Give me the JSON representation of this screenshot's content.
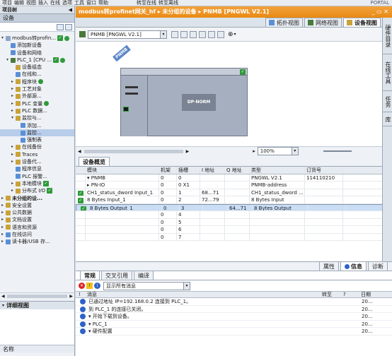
{
  "toolbar": {
    "items": [
      "项目",
      "编辑",
      "视图",
      "插入",
      "在线",
      "选项",
      "工具",
      "窗口",
      "帮助"
    ],
    "online_label": "转至在线",
    "offline_label": "转至离线",
    "brand": "PORTAL"
  },
  "left": {
    "title": "项目树",
    "devices_label": "设备",
    "tree": [
      {
        "label": "modbus转profin...",
        "indent": 0,
        "arrow": "▾",
        "icon": "#8ca6c8",
        "check": true,
        "dot": true
      },
      {
        "label": "添加新设备",
        "indent": 1,
        "arrow": "",
        "icon": "#5a8fd6",
        "check": false,
        "dot": false
      },
      {
        "label": "设备和网络",
        "indent": 1,
        "arrow": "",
        "icon": "#5a8fd6",
        "check": false,
        "dot": false
      },
      {
        "label": "PLC_1 [CPU ...",
        "indent": 1,
        "arrow": "▾",
        "icon": "#4a7a3a",
        "check": true,
        "dot": true
      },
      {
        "label": "设备组态",
        "indent": 2,
        "arrow": "",
        "icon": "#c9a23a",
        "check": false,
        "dot": false
      },
      {
        "label": "在线和...",
        "indent": 2,
        "arrow": "",
        "icon": "#5a8fd6",
        "check": false,
        "dot": false
      },
      {
        "label": "程序块",
        "indent": 2,
        "arrow": "▸",
        "icon": "#c9a23a",
        "check": false,
        "dot": true
      },
      {
        "label": "工艺对象",
        "indent": 2,
        "arrow": "▸",
        "icon": "#c9a23a",
        "check": false,
        "dot": false
      },
      {
        "label": "外部源...",
        "indent": 2,
        "arrow": "▸",
        "icon": "#c9a23a",
        "check": false,
        "dot": false
      },
      {
        "label": "PLC 变量",
        "indent": 2,
        "arrow": "▸",
        "icon": "#c9a23a",
        "check": false,
        "dot": true
      },
      {
        "label": "PLC 数据...",
        "indent": 2,
        "arrow": "▸",
        "icon": "#c9a23a",
        "check": false,
        "dot": false
      },
      {
        "label": "监控与...",
        "indent": 2,
        "arrow": "▾",
        "icon": "#c9a23a",
        "check": false,
        "dot": false
      },
      {
        "label": "添加...",
        "indent": 3,
        "arrow": "",
        "icon": "#5a8fd6",
        "check": false,
        "dot": false
      },
      {
        "label": "监控...",
        "indent": 3,
        "arrow": "",
        "icon": "#5a8fd6",
        "check": false,
        "dot": false,
        "selected": true
      },
      {
        "label": "强制表",
        "indent": 3,
        "arrow": "",
        "icon": "#5a8fd6",
        "check": false,
        "dot": false
      },
      {
        "label": "在线备份",
        "indent": 2,
        "arrow": "▸",
        "icon": "#c9a23a",
        "check": false,
        "dot": false
      },
      {
        "label": "Traces",
        "indent": 2,
        "arrow": "▸",
        "icon": "#c9a23a",
        "check": false,
        "dot": false
      },
      {
        "label": "设备代...",
        "indent": 2,
        "arrow": "▸",
        "icon": "#c9a23a",
        "check": false,
        "dot": false
      },
      {
        "label": "程序信息",
        "indent": 2,
        "arrow": "",
        "icon": "#5a8fd6",
        "check": false,
        "dot": false
      },
      {
        "label": "PLC 报警...",
        "indent": 2,
        "arrow": "",
        "icon": "#5a8fd6",
        "check": false,
        "dot": false
      },
      {
        "label": "本地模块",
        "indent": 2,
        "arrow": "▸",
        "icon": "#c9a23a",
        "check": true,
        "dot": false
      },
      {
        "label": "分布式 I/O",
        "indent": 2,
        "arrow": "▸",
        "icon": "#c9a23a",
        "check": true,
        "dot": false
      },
      {
        "label": "未分组的设...",
        "indent": 0,
        "arrow": "▸",
        "icon": "#c9a23a",
        "check": false,
        "dot": false,
        "bold": true
      },
      {
        "label": "安全设置",
        "indent": 0,
        "arrow": "▸",
        "icon": "#c9a23a",
        "check": false,
        "dot": false
      },
      {
        "label": "公共数据",
        "indent": 0,
        "arrow": "▸",
        "icon": "#c9a23a",
        "check": false,
        "dot": false
      },
      {
        "label": "文档设置",
        "indent": 0,
        "arrow": "▸",
        "icon": "#c9a23a",
        "check": false,
        "dot": false
      },
      {
        "label": "语言和资源",
        "indent": 0,
        "arrow": "▸",
        "icon": "#c9a23a",
        "check": false,
        "dot": false
      },
      {
        "label": "在线访问",
        "indent": 0,
        "arrow": "▸",
        "icon": "#5a8fd6",
        "check": false,
        "dot": false
      },
      {
        "label": "读卡器/USB 存...",
        "indent": 0,
        "arrow": "▸",
        "icon": "#5a8fd6",
        "check": false,
        "dot": false
      }
    ],
    "detail_title": "详细视图",
    "detail_col": "名称"
  },
  "main": {
    "title": "modbus转profinet网关_hf  ▸  未分组的设备  ▸  PNMB [PNGWL V2.1]",
    "tabs": [
      "拓扑视图",
      "网络视图",
      "设备视图"
    ],
    "device_select": "PNMB [PNGWL V2.1]",
    "device_tag": "PNMB",
    "module_label": "DP-NORM",
    "zoom": "100%"
  },
  "overview": {
    "tab": "设备概览",
    "columns": [
      "",
      "模块",
      "机架",
      "插槽",
      "I 地址",
      "Q 地址",
      "类型",
      "订货号"
    ],
    "rows": [
      {
        "check": false,
        "module": "▾  PNMB",
        "rack": "0",
        "slot": "0",
        "i": "",
        "q": "",
        "type": "PNGWL V2.1",
        "order": "114110210"
      },
      {
        "check": false,
        "module": "     ▸  PN-IO",
        "rack": "0",
        "slot": "0 X1",
        "i": "",
        "q": "",
        "type": "PNMB-address",
        "order": ""
      },
      {
        "check": true,
        "module": "CH1_status_dword Input_1",
        "rack": "0",
        "slot": "1",
        "i": "68...71",
        "q": "",
        "type": "CH1_status_dword ...",
        "order": ""
      },
      {
        "check": true,
        "module": "8 Bytes Input_1",
        "rack": "0",
        "slot": "2",
        "i": "72...79",
        "q": "",
        "type": "8 Bytes Input",
        "order": ""
      },
      {
        "check": true,
        "module": "8 Bytes Output_1",
        "rack": "0",
        "slot": "3",
        "i": "",
        "q": "64...71",
        "type": "8 Bytes Output",
        "order": "",
        "selected": true
      },
      {
        "check": false,
        "module": "",
        "rack": "0",
        "slot": "4",
        "i": "",
        "q": "",
        "type": "",
        "order": ""
      },
      {
        "check": false,
        "module": "",
        "rack": "0",
        "slot": "5",
        "i": "",
        "q": "",
        "type": "",
        "order": ""
      },
      {
        "check": false,
        "module": "",
        "rack": "0",
        "slot": "6",
        "i": "",
        "q": "",
        "type": "",
        "order": ""
      },
      {
        "check": false,
        "module": "",
        "rack": "0",
        "slot": "7",
        "i": "",
        "q": "",
        "type": "",
        "order": ""
      }
    ]
  },
  "inspector": {
    "top_tabs": [
      "属性",
      "信息",
      "诊断"
    ],
    "tabs": [
      "常规",
      "交叉引用",
      "编译"
    ],
    "filter": "显示所有消息",
    "cols": [
      "!",
      "消息",
      "转至",
      "?",
      "日期"
    ],
    "messages": [
      {
        "text": "已通过地址 IP=192.168.0.2 连接到 PLC_1。",
        "date": "20..."
      },
      {
        "text": "到 PLC_1 的连接已关闭。",
        "date": "20..."
      },
      {
        "text": "▾  开始下载到设备。",
        "date": "20..."
      },
      {
        "text": "      ▾  PLC_1",
        "date": "20..."
      },
      {
        "text": "            ▾  硬件配置",
        "date": "20..."
      }
    ]
  }
}
